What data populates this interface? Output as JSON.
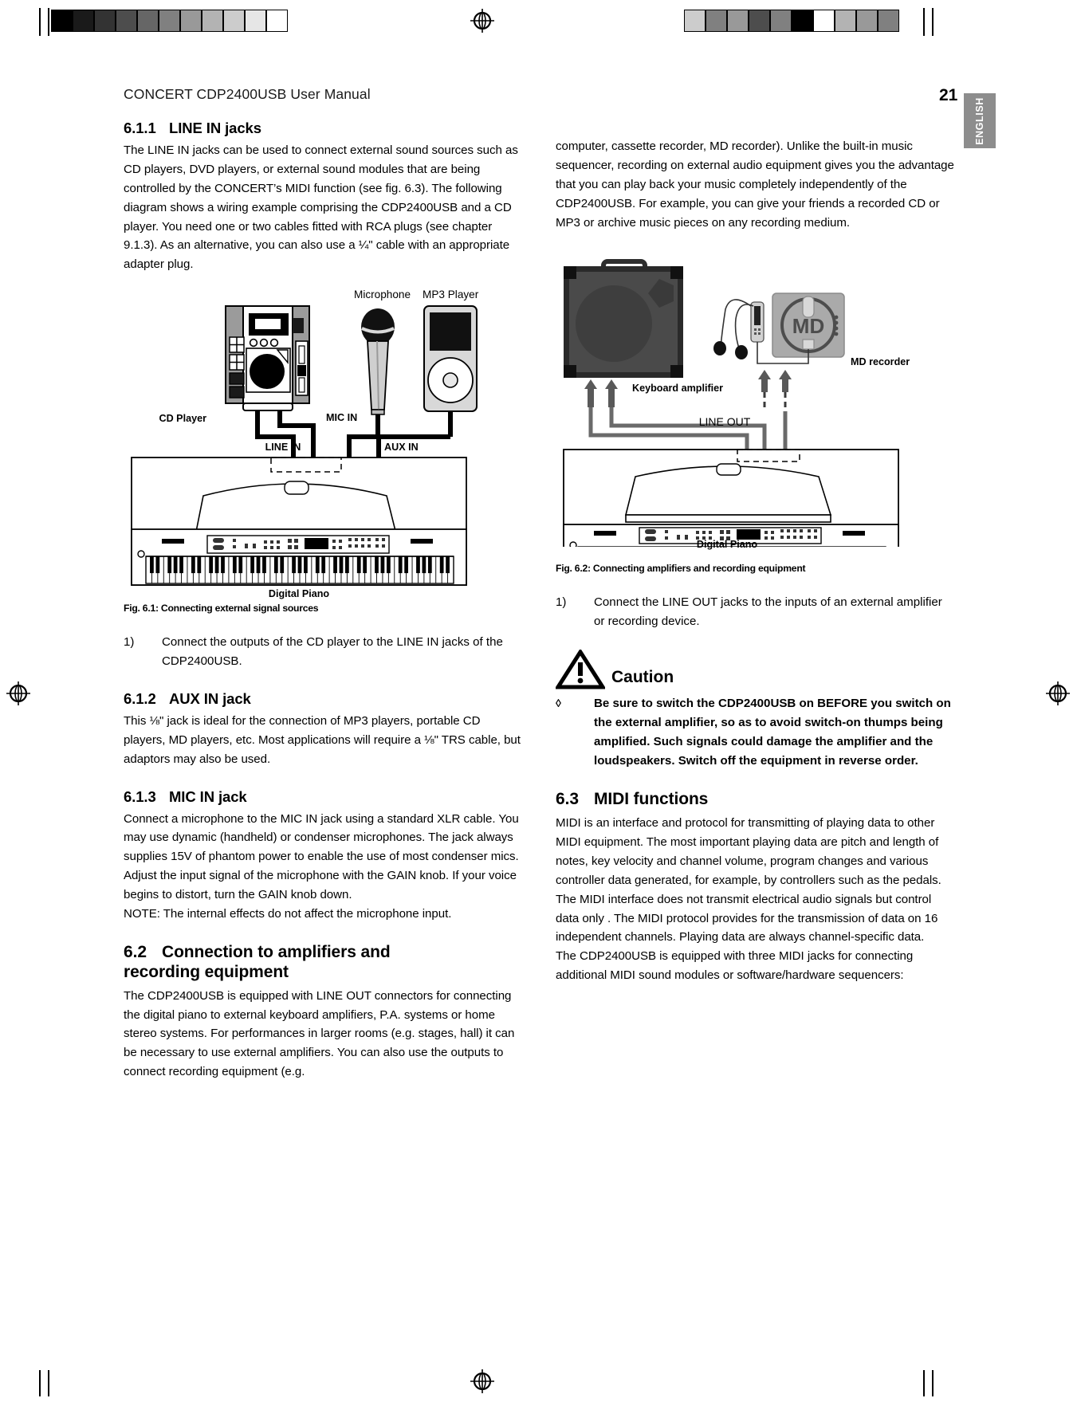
{
  "header": {
    "title": "CONCERT CDP2400USB User Manual",
    "page_number": "21",
    "language_tab": "ENGLISH"
  },
  "left_column": {
    "section_611": {
      "number": "6.1.1",
      "title": "LINE IN jacks",
      "body": "The LINE IN jacks can be used to connect external sound sources such as CD players, DVD players, or external sound modules that are being controlled by the CONCERT’s MIDI function (see fig. 6.3). The following diagram shows a wiring example comprising the CDP2400USB and a CD player. You need one or two cables fitted with RCA plugs (see chapter 9.1.3). As an alternative, you can also use a ¼\" cable with an appropriate adapter plug."
    },
    "figure_61": {
      "caption": "Fig. 6.1: Connecting external signal sources",
      "labels": {
        "cd_player": "CD Player",
        "microphone": "Microphone",
        "mp3_player": "MP3 Player",
        "mic_in": "MIC IN",
        "line_in": "LINE IN",
        "aux_in": "AUX IN",
        "digital_piano": "Digital Piano"
      }
    },
    "step_1": {
      "marker": "1)",
      "text": "Connect the outputs of the CD player to the LINE IN jacks of the CDP2400USB."
    },
    "section_612": {
      "number": "6.1.2",
      "title": "AUX IN jack",
      "body": "This ⅛\" jack is ideal for the connection of MP3 players, portable CD players, MD players, etc. Most applications will require a ⅛\" TRS cable, but adaptors may also be used."
    },
    "section_613": {
      "number": "6.1.3",
      "title": "MIC IN jack",
      "body_1": "Connect a microphone to the MIC IN jack using a standard XLR cable. You may use dynamic (handheld) or condenser microphones. The jack always supplies 15V of phantom power to enable the use of most condenser mics.",
      "body_2": "Adjust the input signal of the microphone with the GAIN knob. If your voice begins to distort, turn the GAIN knob down.",
      "body_3": "NOTE: The internal effects do not affect the microphone input."
    },
    "section_62": {
      "number": "6.2",
      "title_line1": "Connection to amplifiers and",
      "title_line2": "recording equipment",
      "body": "The CDP2400USB is equipped with LINE OUT connectors for connecting the digital piano to external keyboard amplifiers, P.A. systems or home stereo systems. For performances in larger rooms (e.g. stages, hall) it can be necessary to use external amplifiers. You can also use the outputs to connect recording equipment (e.g."
    }
  },
  "right_column": {
    "continued_body": "computer, cassette recorder, MD recorder). Unlike the built-in music sequencer, recording on external audio equipment gives you the advantage that you can play back your music completely independently of the CDP2400USB. For example, you can give your friends a recorded CD or MP3 or archive music pieces on any recording medium.",
    "figure_62": {
      "caption": "Fig. 6.2: Connecting amplifiers and recording equipment",
      "labels": {
        "keyboard_amplifier": "Keyboard amplifier",
        "md_recorder": "MD recorder",
        "md_badge": "MD",
        "line_out": "LINE OUT",
        "digital_piano": "Digital Piano"
      }
    },
    "step_1": {
      "marker": "1)",
      "text": "Connect the LINE OUT jacks to the inputs of an external amplifier or recording device."
    },
    "caution": {
      "title": "Caution",
      "bullet_marker": "◊",
      "text": "Be sure to switch the CDP2400USB on BEFORE you switch on the external amplifier, so as to avoid switch-on thumps being amplified. Such signals could damage the amplifier and the loudspeakers. Switch off the equipment in reverse order."
    },
    "section_63": {
      "number": "6.3",
      "title": "MIDI functions",
      "body_1": "MIDI is an interface and protocol for transmitting of playing data to other MIDI equipment. The most important playing data are pitch and length of notes, key velocity and channel volume, program changes and various controller data generated, for example, by controllers such as the pedals.",
      "body_2": "The MIDI interface does not transmit electrical audio signals but control data only . The MIDI protocol provides for the transmission of data on 16 independent channels. Playing data are always channel-specific data.",
      "body_3": "The CDP2400USB is equipped with three MIDI jacks for connecting additional MIDI sound modules or software/hardware sequencers:"
    }
  },
  "print_marks": {
    "left_swatches": [
      "#000000",
      "#1a1a1a",
      "#333333",
      "#4d4d4d",
      "#666666",
      "#808080",
      "#999999",
      "#b3b3b3",
      "#cccccc",
      "#e6e6e6",
      "#ffffff"
    ],
    "right_swatches": [
      "#cccccc",
      "#808080",
      "#999999",
      "#4d4d4d",
      "#808080",
      "#000000",
      "#ffffff",
      "#b3b3b3",
      "#999999",
      "#808080"
    ]
  }
}
